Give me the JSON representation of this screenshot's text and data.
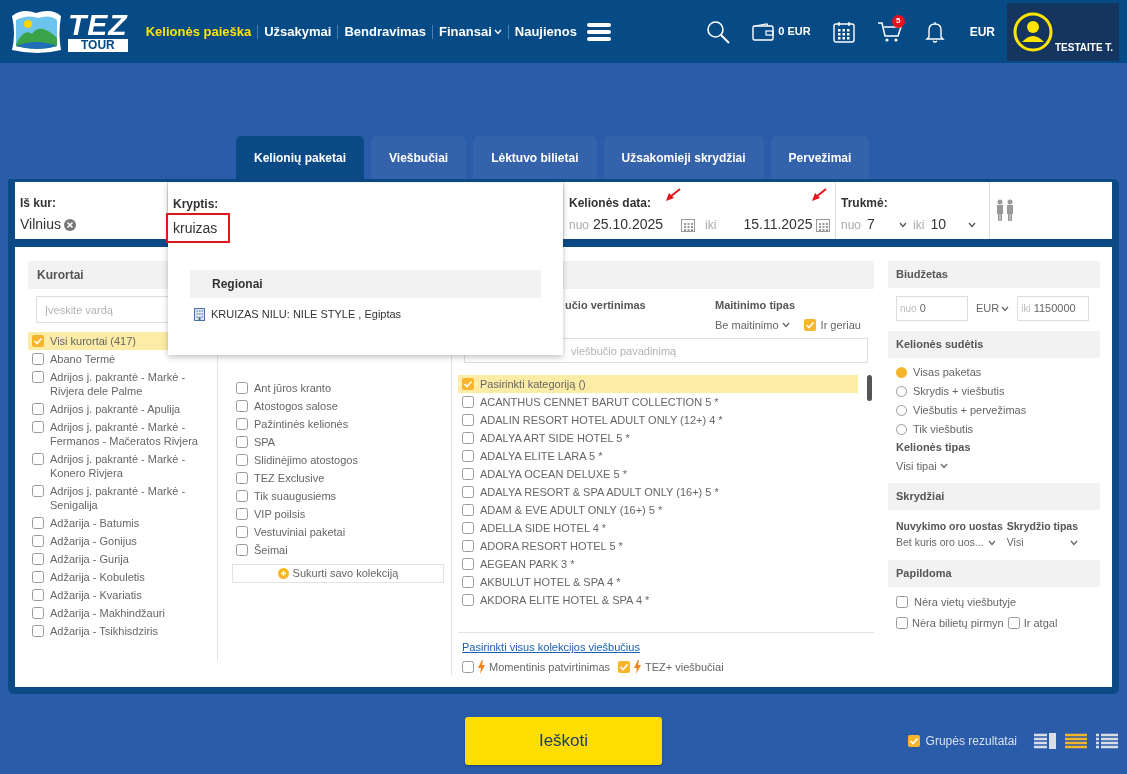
{
  "header": {
    "logo": {
      "top": "TEZ",
      "bottom": "TOUR"
    },
    "nav": [
      {
        "label": "Kelionės paieška",
        "selected": true,
        "kind": "link"
      },
      {
        "label": "Užsakymai",
        "selected": false,
        "kind": "link"
      },
      {
        "label": "Bendravimas",
        "selected": false,
        "kind": "link"
      },
      {
        "label": "Finansai",
        "selected": false,
        "kind": "dropdown"
      },
      {
        "label": "Naujienos",
        "selected": false,
        "kind": "link"
      }
    ],
    "wallet": "0 EUR",
    "cart_count": "5",
    "currency": "EUR",
    "user": "TESTAITE T."
  },
  "tabs": [
    {
      "label": "Kelionių paketai",
      "selected": true
    },
    {
      "label": "Viešbučiai",
      "selected": false
    },
    {
      "label": "Lėktuvo bilietai",
      "selected": false
    },
    {
      "label": "Užsakomieji skrydžiai",
      "selected": false
    },
    {
      "label": "Pervežimai",
      "selected": false
    }
  ],
  "search": {
    "from": {
      "label": "Iš kur:",
      "value": "Vilnius"
    },
    "destination": {
      "label": "Kryptis:",
      "value": "kruizas",
      "section": "Regionai",
      "results": [
        "KRUIZAS NILU: NILE STYLE , Egiptas"
      ]
    },
    "dates": {
      "label": "Kelionės data:",
      "from_prefix": "nuo",
      "from": "25.10.2025",
      "to_prefix": "iki",
      "to": "15.11.2025"
    },
    "duration": {
      "label": "Trukmė:",
      "from_prefix": "nuo",
      "from": "7",
      "to_prefix": "iki",
      "to": "10"
    }
  },
  "resorts": {
    "title": "Kurortai",
    "placeholder": "Įveskite vardą",
    "items": [
      {
        "label": "Visi kurortai (417)",
        "checked": true
      },
      {
        "label": "Abano Termė",
        "checked": false
      },
      {
        "label": "Adrijos j. pakrantė - Markė - Rivjera dele Palme",
        "checked": false
      },
      {
        "label": "Adrijos j. pakrantė - Apulija",
        "checked": false
      },
      {
        "label": "Adrijos j. pakrantė - Markė - Fermanos - Mačeratos Rivjera",
        "checked": false
      },
      {
        "label": "Adrijos j. pakrantė - Markė - Konero Rivjera",
        "checked": false
      },
      {
        "label": "Adrijos j. pakrantė - Markė - Senigalija",
        "checked": false
      },
      {
        "label": "Adžarija - Batumis",
        "checked": false
      },
      {
        "label": "Adžarija - Gonijus",
        "checked": false
      },
      {
        "label": "Adžarija - Gurija",
        "checked": false
      },
      {
        "label": "Adžarija - Kobuletis",
        "checked": false
      },
      {
        "label": "Adžarija - Kvariatis",
        "checked": false
      },
      {
        "label": "Adžarija - Makhindžauri",
        "checked": false
      },
      {
        "label": "Adžarija - Tsikhisdziris",
        "checked": false
      }
    ]
  },
  "collections": {
    "items": [
      {
        "label": "Ant jūros kranto",
        "checked": false
      },
      {
        "label": "Atostogos salose",
        "checked": false
      },
      {
        "label": "Pažintinės kelionės",
        "checked": false
      },
      {
        "label": "SPA",
        "checked": false
      },
      {
        "label": "Slidinėjimo atostogos",
        "checked": false
      },
      {
        "label": "TEZ Exclusive",
        "checked": false
      },
      {
        "label": "Tik suaugusiems",
        "checked": false
      },
      {
        "label": "VIP poilsis",
        "checked": false
      },
      {
        "label": "Vestuviniai paketai",
        "checked": false
      },
      {
        "label": "Šeimai",
        "checked": false
      }
    ],
    "create_button": "Sukurti savo kolekciją"
  },
  "hotels": {
    "rating_label": "učio vertinimas",
    "meal_label": "Maitinimo tipas",
    "meal_value": "Be maitinimo",
    "or_better": {
      "label": "Ir geriau",
      "checked": true
    },
    "placeholder": "viešbučio pavadinimą",
    "items": [
      {
        "label": "Pasirinkti kategoriją ()",
        "checked": true
      },
      {
        "label": "ACANTHUS CENNET BARUT COLLECTION 5 *",
        "checked": false
      },
      {
        "label": "ADALIN RESORT HOTEL ADULT ONLY (12+) 4 *",
        "checked": false
      },
      {
        "label": "ADALYA ART SIDE HOTEL 5 *",
        "checked": false
      },
      {
        "label": "ADALYA ELITE LARA 5 *",
        "checked": false
      },
      {
        "label": "ADALYA OCEAN DELUXE 5 *",
        "checked": false
      },
      {
        "label": "ADALYA RESORT & SPA ADULT ONLY (16+) 5 *",
        "checked": false
      },
      {
        "label": "ADAM & EVE ADULT ONLY (16+) 5 *",
        "checked": false
      },
      {
        "label": "ADELLA SIDE HOTEL 4 *",
        "checked": false
      },
      {
        "label": "ADORA RESORT HOTEL 5 *",
        "checked": false
      },
      {
        "label": "AEGEAN PARK 3 *",
        "checked": false
      },
      {
        "label": "AKBULUT HOTEL & SPA 4 *",
        "checked": false
      },
      {
        "label": "AKDORA ELITE HOTEL & SPA 4 *",
        "checked": false
      }
    ],
    "select_all_link": "Pasirinkti visus kolekcijos viešbučius",
    "flags": [
      {
        "label": "Momentinis patvirtinimas",
        "checked": false
      },
      {
        "label": "TEZ+ viešbučiai",
        "checked": true
      }
    ]
  },
  "filters": {
    "budget": {
      "title": "Biudžetas",
      "from_prefix": "nuo",
      "from": "0",
      "currency": "EUR",
      "to_prefix": "iki",
      "to": "1150000"
    },
    "composition": {
      "title": "Kelionės sudėtis",
      "options": [
        {
          "label": "Visas paketas",
          "selected": true
        },
        {
          "label": "Skrydis + viešbutis",
          "selected": false
        },
        {
          "label": "Viešbutis + pervežimas",
          "selected": false
        },
        {
          "label": "Tik viešbutis",
          "selected": false
        }
      ],
      "type_label": "Kelionės tipas",
      "type_value": "Visi tipai"
    },
    "flights": {
      "title": "Skrydžiai",
      "airport_label": "Nuvykimo oro uostas",
      "airport_value": "Bet kuris oro uos...",
      "flight_type_label": "Skrydžio tipas",
      "flight_type_value": "Visi"
    },
    "extra": {
      "title": "Papildoma",
      "items": [
        {
          "label": "Nėra vietų viešbutyje",
          "checked": false
        },
        {
          "label": "Nėra bilietų pirmyn",
          "checked": false
        },
        {
          "label": "Ir atgal",
          "checked": false
        }
      ]
    }
  },
  "footer": {
    "search_button": "Ieškoti",
    "group_results": {
      "label": "Grupės rezultatai",
      "checked": true
    },
    "views": [
      {
        "selected": false
      },
      {
        "selected": true
      },
      {
        "selected": false
      }
    ]
  }
}
